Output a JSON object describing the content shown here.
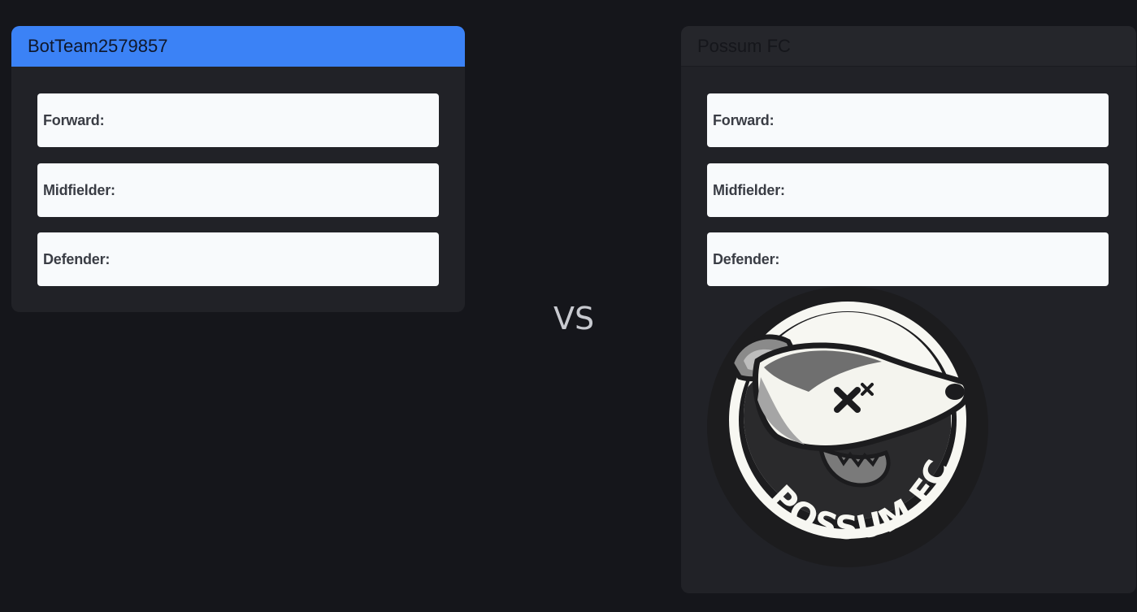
{
  "left_team": {
    "name": "BotTeam2579857",
    "accent": "#3b82f6",
    "slots": [
      {
        "label": "Forward:",
        "player": ""
      },
      {
        "label": "Midfielder:",
        "player": ""
      },
      {
        "label": "Defender:",
        "player": ""
      }
    ]
  },
  "versus": "VS",
  "right_team": {
    "name": "Possum FC",
    "slots": [
      {
        "label": "Forward:",
        "player": ""
      },
      {
        "label": "Midfielder:",
        "player": ""
      },
      {
        "label": "Defender:",
        "player": ""
      }
    ],
    "logo": {
      "icon": "possum-fc-crest",
      "text": "POSSUM FC"
    }
  }
}
